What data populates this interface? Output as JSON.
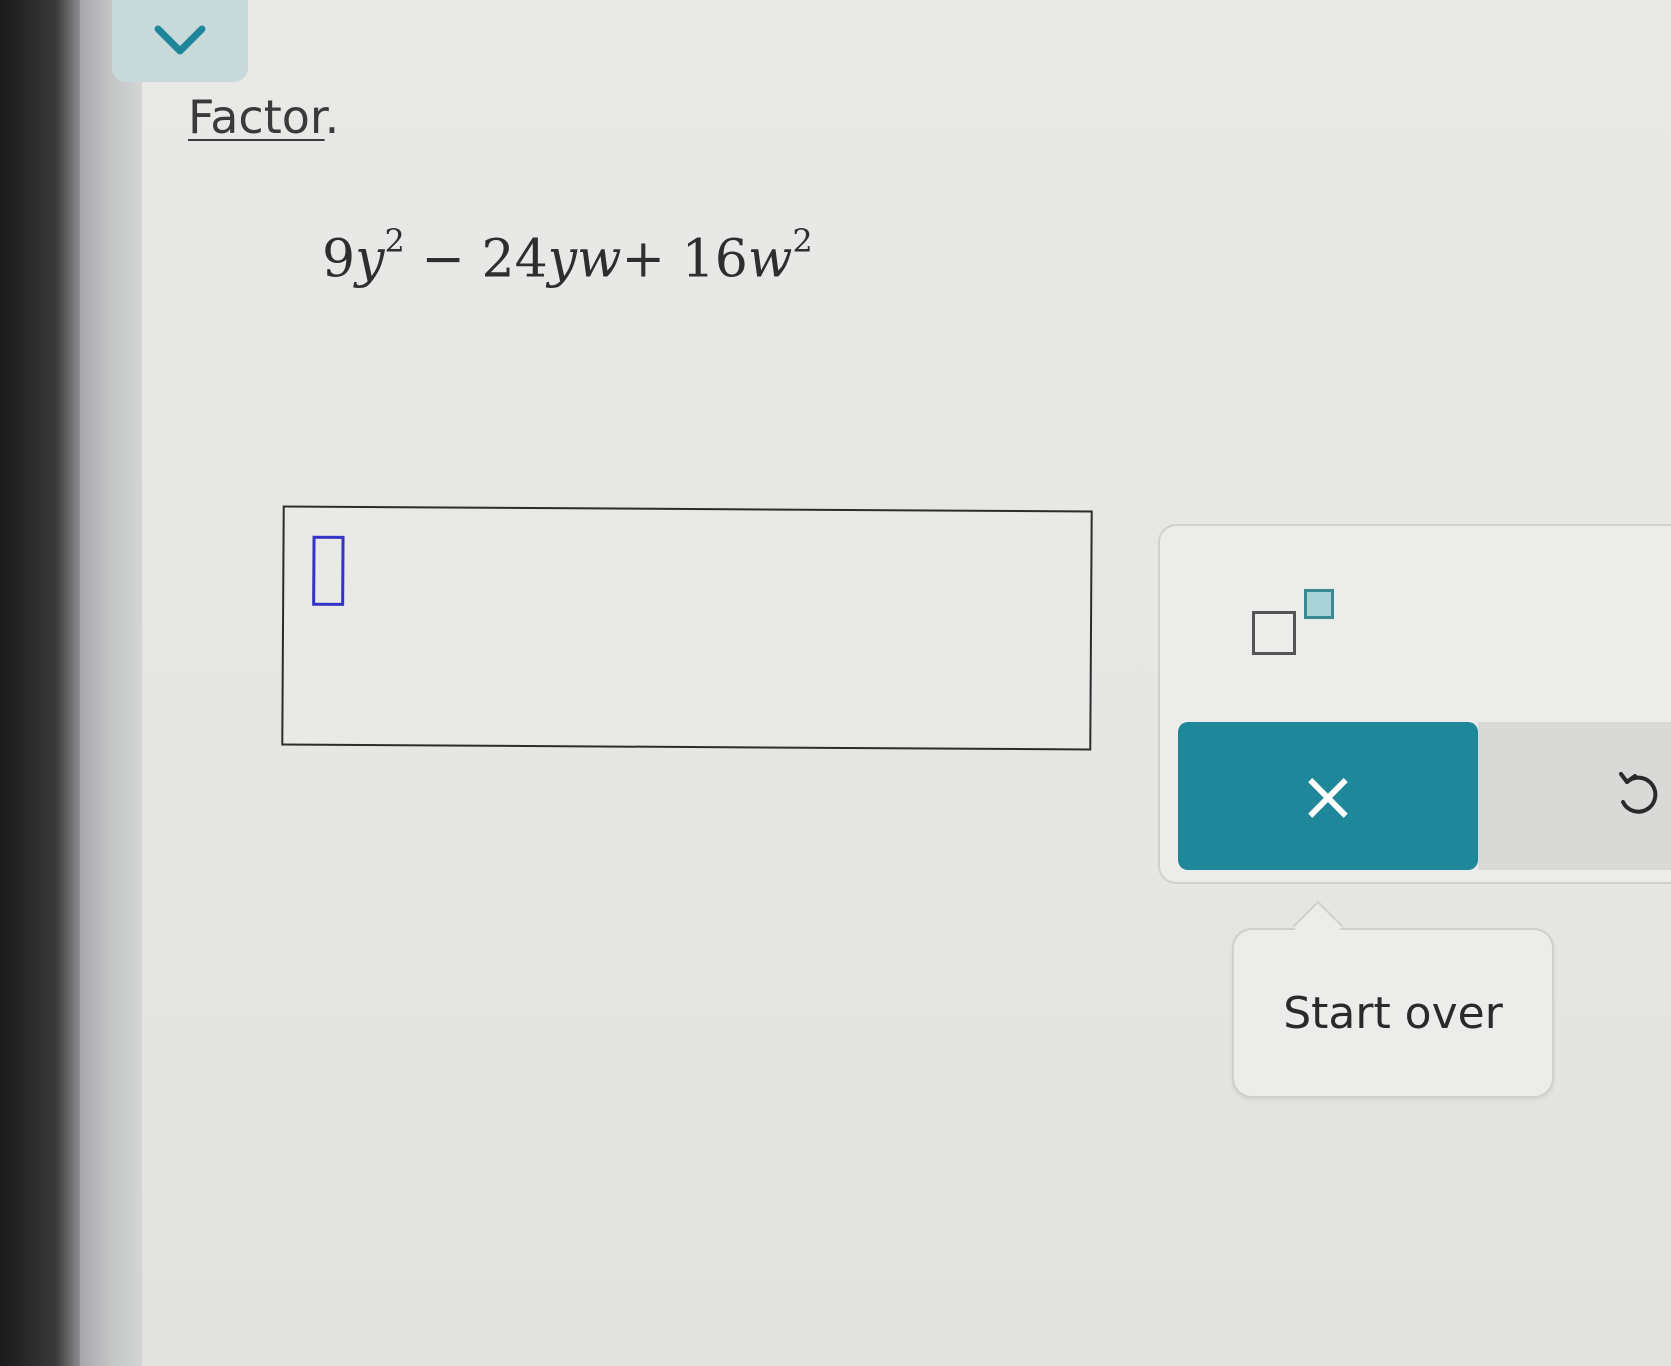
{
  "header": {
    "collapse_icon": "chevron-down-icon",
    "accent": "#c9dadc"
  },
  "question": {
    "instruction_link": "Factor",
    "instruction_punct": ".",
    "expression": {
      "t1_coef": "9",
      "t1_var": "y",
      "t1_exp": "2",
      "op1": "−",
      "t2": "24",
      "t2_vars": "yw",
      "op2": "+",
      "t3_coef": "16",
      "t3_var": "w",
      "t3_exp": "2"
    }
  },
  "answer": {
    "value": "",
    "cursor_color": "#3434c8"
  },
  "keypad": {
    "superscript_icon": "superscript-template-icon",
    "clear_label": "×",
    "clear_color": "#1f879a",
    "undo_icon": "undo-icon"
  },
  "tooltip": {
    "label": "Start over"
  }
}
